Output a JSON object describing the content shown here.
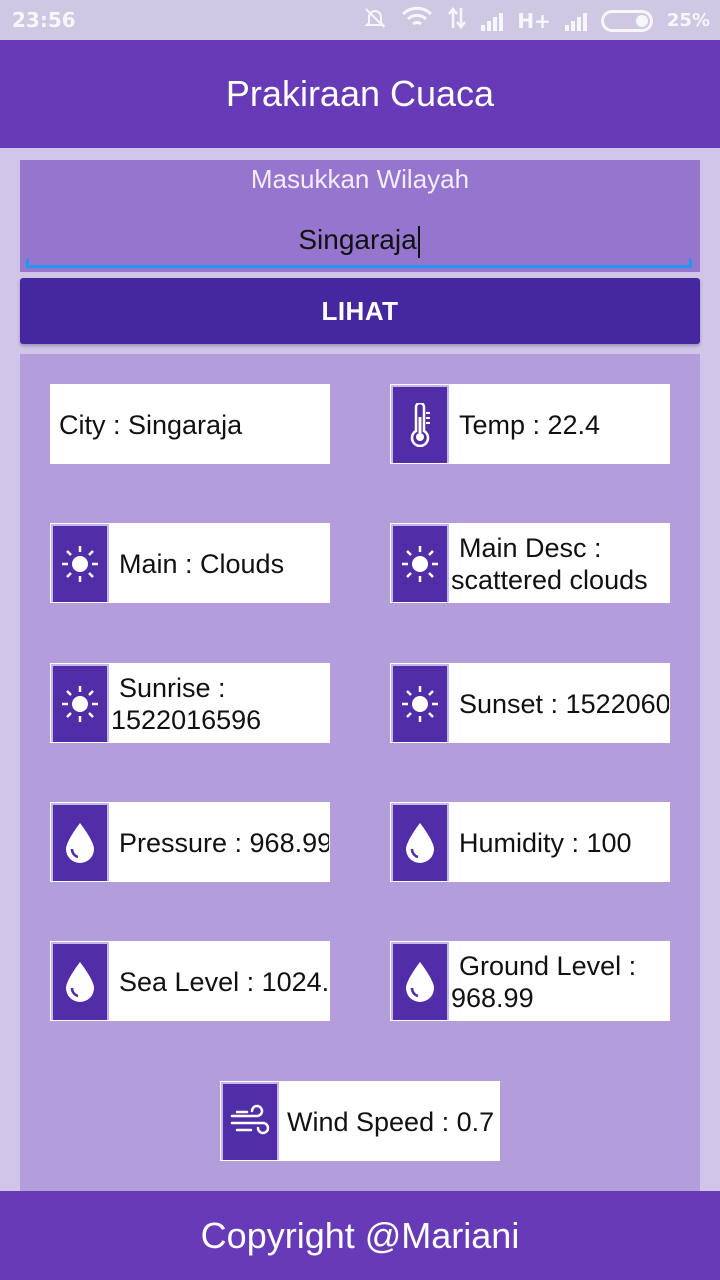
{
  "status_bar": {
    "time": "23:56",
    "network": "H+",
    "battery": "25%",
    "icons": [
      "mute-icon",
      "wifi-icon",
      "data-icon",
      "signal-icon",
      "signal-icon",
      "battery-icon"
    ]
  },
  "app_bar": {
    "title": "Prakiraan Cuaca"
  },
  "input": {
    "label": "Masukkan Wilayah",
    "value": "Singaraja"
  },
  "button": {
    "label": "LIHAT"
  },
  "results": {
    "city": "City : Singaraja",
    "temp": "Temp : 22.4",
    "main": "Main : Clouds",
    "main_desc_line1": "Main Desc :",
    "main_desc_line2": "scattered clouds",
    "sunrise_line1": "Sunrise :",
    "sunrise_line2": "1522016596",
    "sunset": "Sunset : 1522060",
    "pressure": "Pressure : 968.99",
    "humidity": "Humidity : 100",
    "sea_level": "Sea Level : 1024.",
    "ground_level_line1": "Ground Level :",
    "ground_level_line2": "968.99",
    "wind_speed": "Wind Speed : 0.7"
  },
  "footer": {
    "text": "Copyright @Mariani"
  },
  "colors": {
    "primary": "#673ab7",
    "primary_dark": "#4527a0",
    "panel": "#9575cd",
    "result_panel": "#b39ddb",
    "icon_bg": "#512da8",
    "accent": "#2196f3"
  }
}
